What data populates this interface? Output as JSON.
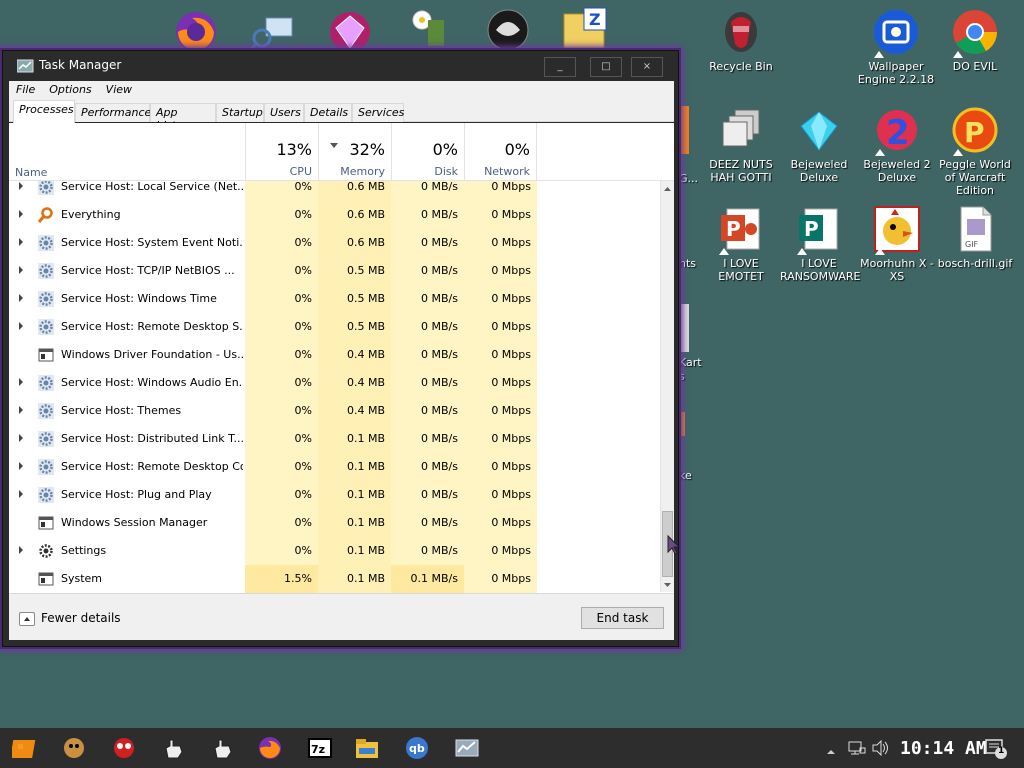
{
  "desktop": {
    "icons": [
      {
        "id": "recycle-bin",
        "label": "Recycle Bin"
      },
      {
        "id": "wallpaper-engine",
        "label": "Wallpaper Engine 2.2.18"
      },
      {
        "id": "do-evil",
        "label": "DO EVIL"
      },
      {
        "id": "deez-nuts",
        "label": "DEEZ NUTS HAH GOTTI"
      },
      {
        "id": "bejeweled-deluxe",
        "label": "Bejeweled Deluxe"
      },
      {
        "id": "bejeweled-2",
        "label": "Bejeweled 2 Deluxe"
      },
      {
        "id": "peggle",
        "label": "Peggle World of Warcraft Edition"
      },
      {
        "id": "i-love-emotet",
        "label": "I LOVE EMOTET"
      },
      {
        "id": "i-love-ransomware",
        "label": "I LOVE RANSOMWARE"
      },
      {
        "id": "moorhuhn",
        "label": "Moorhuhn X - XS"
      },
      {
        "id": "bosch-drill",
        "label": "bosch-drill.gif"
      }
    ],
    "partial_labels": [
      "G...",
      "hts",
      "Kart",
      "s",
      "ke"
    ]
  },
  "task_manager": {
    "title": "Task Manager",
    "window_buttons": {
      "minimize": "_",
      "maximize": "□",
      "close": "×"
    },
    "menu": [
      "File",
      "Options",
      "View"
    ],
    "tabs": [
      "Processes",
      "Performance",
      "App history",
      "Startup",
      "Users",
      "Details",
      "Services"
    ],
    "active_tab": "Processes",
    "columns": {
      "name": "Name",
      "cpu": {
        "pct": "13%",
        "label": "CPU"
      },
      "memory": {
        "pct": "32%",
        "label": "Memory"
      },
      "disk": {
        "pct": "0%",
        "label": "Disk"
      },
      "network": {
        "pct": "0%",
        "label": "Network"
      }
    },
    "rows": [
      {
        "name": "Service Host: Local Service (Net...",
        "cpu": "0%",
        "mem": "0.6 MB",
        "disk": "0 MB/s",
        "net": "0 Mbps",
        "expand": true,
        "icon": "gear-icon"
      },
      {
        "name": "Everything",
        "cpu": "0%",
        "mem": "0.6 MB",
        "disk": "0 MB/s",
        "net": "0 Mbps",
        "expand": true,
        "icon": "magnifier-icon"
      },
      {
        "name": "Service Host: System Event Noti...",
        "cpu": "0%",
        "mem": "0.6 MB",
        "disk": "0 MB/s",
        "net": "0 Mbps",
        "expand": true,
        "icon": "gear-icon"
      },
      {
        "name": "Service Host: TCP/IP NetBIOS ...",
        "cpu": "0%",
        "mem": "0.5 MB",
        "disk": "0 MB/s",
        "net": "0 Mbps",
        "expand": true,
        "icon": "gear-icon"
      },
      {
        "name": "Service Host: Windows Time",
        "cpu": "0%",
        "mem": "0.5 MB",
        "disk": "0 MB/s",
        "net": "0 Mbps",
        "expand": true,
        "icon": "gear-icon"
      },
      {
        "name": "Service Host: Remote Desktop S...",
        "cpu": "0%",
        "mem": "0.5 MB",
        "disk": "0 MB/s",
        "net": "0 Mbps",
        "expand": true,
        "icon": "gear-icon"
      },
      {
        "name": "Windows Driver Foundation - Us...",
        "cpu": "0%",
        "mem": "0.4 MB",
        "disk": "0 MB/s",
        "net": "0 Mbps",
        "expand": false,
        "icon": "window-icon"
      },
      {
        "name": "Service Host: Windows Audio En...",
        "cpu": "0%",
        "mem": "0.4 MB",
        "disk": "0 MB/s",
        "net": "0 Mbps",
        "expand": true,
        "icon": "gear-icon"
      },
      {
        "name": "Service Host: Themes",
        "cpu": "0%",
        "mem": "0.4 MB",
        "disk": "0 MB/s",
        "net": "0 Mbps",
        "expand": true,
        "icon": "gear-icon"
      },
      {
        "name": "Service Host: Distributed Link T...",
        "cpu": "0%",
        "mem": "0.1 MB",
        "disk": "0 MB/s",
        "net": "0 Mbps",
        "expand": true,
        "icon": "gear-icon"
      },
      {
        "name": "Service Host: Remote Desktop Co...",
        "cpu": "0%",
        "mem": "0.1 MB",
        "disk": "0 MB/s",
        "net": "0 Mbps",
        "expand": true,
        "icon": "gear-icon"
      },
      {
        "name": "Service Host: Plug and Play",
        "cpu": "0%",
        "mem": "0.1 MB",
        "disk": "0 MB/s",
        "net": "0 Mbps",
        "expand": true,
        "icon": "gear-icon"
      },
      {
        "name": "Windows Session Manager",
        "cpu": "0%",
        "mem": "0.1 MB",
        "disk": "0 MB/s",
        "net": "0 Mbps",
        "expand": false,
        "icon": "window-icon"
      },
      {
        "name": "Settings",
        "cpu": "0%",
        "mem": "0.1 MB",
        "disk": "0 MB/s",
        "net": "0 Mbps",
        "expand": true,
        "icon": "settings-gear-icon"
      },
      {
        "name": "System",
        "cpu": "1.5%",
        "mem": "0.1 MB",
        "disk": "0.1 MB/s",
        "net": "0 Mbps",
        "expand": false,
        "icon": "window-icon"
      }
    ],
    "footer": {
      "fewer_details": "Fewer details",
      "end_task": "End task"
    }
  },
  "taskbar": {
    "apps": [
      "start-icon",
      "mascot-icon",
      "red-face-icon",
      "hand-cursor-icon",
      "hand-cursor-icon",
      "firefox-icon",
      "7zip-icon",
      "file-explorer-icon",
      "qbittorrent-icon",
      "task-manager-icon"
    ],
    "clock": "10:14 AM",
    "notification_count": "1"
  },
  "colors": {
    "desktop_bg": "#3f6665",
    "cpu_column_bg": "#fff4c4",
    "mem_column_bg": "#fff0b5",
    "window_accent": "#6a3a9a"
  }
}
